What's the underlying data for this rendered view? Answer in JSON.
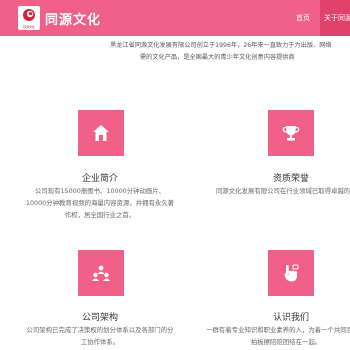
{
  "header": {
    "logo_text": "同源文化",
    "title": "同源文化",
    "nav": [
      {
        "label": "首页"
      },
      {
        "label": "关于同源"
      }
    ]
  },
  "intro": {
    "line1": "黑龙江省同源文化发展有限公司创立于1996年，26年来一直致力于为出版、网络",
    "line2": "需的文化产品，是全国最大的青少年文化创意内容提供商"
  },
  "cards": [
    {
      "title": "企业简介",
      "desc": "公司现有15000册图书、10000分钟动画片、10000分钟教育视频的海量内容资源，并拥有永久著作权，居全国行业之首。",
      "icon": "home-icon"
    },
    {
      "title": "资质荣誉",
      "desc": "同源文化发展有限公司在行业领域已取得卓越的",
      "icon": "trophy-icon"
    },
    {
      "title": "公司架构",
      "desc": "公司架构已完成了决策权的划分体系以及各部门的分工协作体系。",
      "icon": "team-icon"
    },
    {
      "title": "认识我们",
      "desc": "一群有着专业知识和职业素养的人，为着一个共同目标而拍板擦陪陪团结在一起。",
      "icon": "touch-icon"
    }
  ],
  "colors": {
    "brand": "#ef5f87",
    "nav_active": "#e0416d"
  }
}
